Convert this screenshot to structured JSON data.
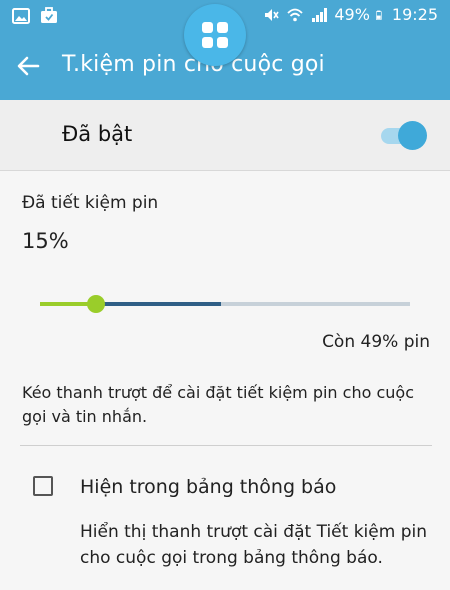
{
  "status_bar": {
    "battery": "49%",
    "time": "19:25",
    "left_icons": [
      "image-icon",
      "briefcase-icon"
    ],
    "right_icons": [
      "mute-icon",
      "wifi-icon",
      "signal-icon",
      "battery-icon"
    ]
  },
  "app_bar": {
    "title": "T.kiệm pin cho cuộc gọi",
    "back_icon": "back-arrow-icon",
    "color": "#4aa8d4"
  },
  "floating_button": {
    "icon": "apps-grid-icon"
  },
  "enabled_row": {
    "label": "Đã bật",
    "switch_on": true,
    "accent": "#3fa9d9"
  },
  "saving": {
    "label": "Đã tiết kiệm pin",
    "percent": "15%",
    "slider_value": 0.15,
    "remaining_label": "Còn 49% pin",
    "remaining_fraction": 0.49,
    "fill_color": "#9acd2a",
    "remaining_color": "#2f5f86"
  },
  "description": "Kéo thanh trượt để cài đặt tiết kiệm pin cho cuộc gọi và tin nhắn.",
  "notification_option": {
    "label": "Hiện trong bảng thông báo",
    "checked": false,
    "description": "Hiển thị thanh trượt cài đặt Tiết kiệm pin cho cuộc gọi trong bảng thông báo."
  }
}
